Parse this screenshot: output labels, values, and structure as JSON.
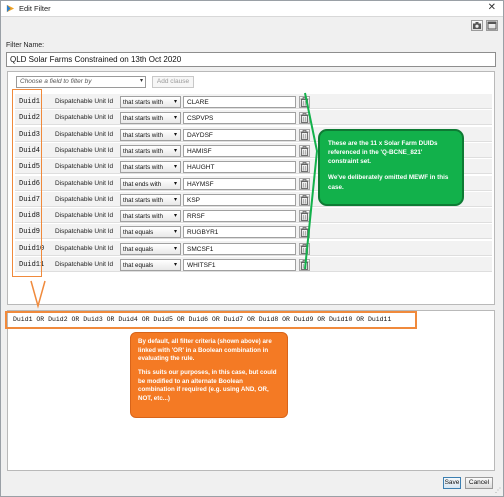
{
  "window": {
    "title": "Edit Filter",
    "close_glyph": "✕",
    "tools": [
      "camera-icon",
      "window-icon"
    ]
  },
  "filter_name": {
    "label": "Filter Name:",
    "value": "QLD Solar Farms Constrained on 13th Oct 2020"
  },
  "clause_toolbar": {
    "field_placeholder": "Choose a field to filter by",
    "add_clause_label": "Add clause"
  },
  "clauses": [
    {
      "id": "Duid1",
      "field": "Dispatchable Unit Id",
      "operator": "that starts with",
      "value": "CLARE"
    },
    {
      "id": "Duid2",
      "field": "Dispatchable Unit Id",
      "operator": "that starts with",
      "value": "CSPVPS"
    },
    {
      "id": "Duid3",
      "field": "Dispatchable Unit Id",
      "operator": "that starts with",
      "value": "DAYDSF"
    },
    {
      "id": "Duid4",
      "field": "Dispatchable Unit Id",
      "operator": "that starts with",
      "value": "HAMISF"
    },
    {
      "id": "Duid5",
      "field": "Dispatchable Unit Id",
      "operator": "that starts with",
      "value": "HAUGHT"
    },
    {
      "id": "Duid6",
      "field": "Dispatchable Unit Id",
      "operator": "that ends with",
      "value": "HAYMSF"
    },
    {
      "id": "Duid7",
      "field": "Dispatchable Unit Id",
      "operator": "that starts with",
      "value": "KSP"
    },
    {
      "id": "Duid8",
      "field": "Dispatchable Unit Id",
      "operator": "that starts with",
      "value": "RRSF"
    },
    {
      "id": "Duid9",
      "field": "Dispatchable Unit Id",
      "operator": "that equals",
      "value": "RUGBYR1"
    },
    {
      "id": "Duid10",
      "field": "Dispatchable Unit Id",
      "operator": "that equals",
      "value": "SMCSF1"
    },
    {
      "id": "Duid11",
      "field": "Dispatchable Unit Id",
      "operator": "that equals",
      "value": "WHITSF1"
    }
  ],
  "green_annotation": {
    "line1": "These are the 11 x Solar Farm DUIDs referenced in the 'Q-BCNE_821' constraint set.",
    "line2": "We've deliberately omitted MEWF in this case."
  },
  "expression": "Duid1 OR Duid2 OR Duid3 OR Duid4 OR Duid5 OR Duid6 OR Duid7 OR Duid8 OR Duid9 OR Duid10 OR Duid11",
  "orange_annotation": {
    "para1": "By default, all filter criteria (shown above) are linked with 'OR' in a Boolean combination in evaluating the rule.",
    "para2": "This suits our purposes, in this case, but could be modified to an alternate Boolean combination if required (e.g. using AND, OR, NOT, etc...)"
  },
  "buttons": {
    "save": "Save",
    "cancel": "Cancel"
  },
  "colors": {
    "green_note": "#12b14b",
    "orange_note": "#f47a24",
    "highlight_orange": "#f08a3c"
  }
}
